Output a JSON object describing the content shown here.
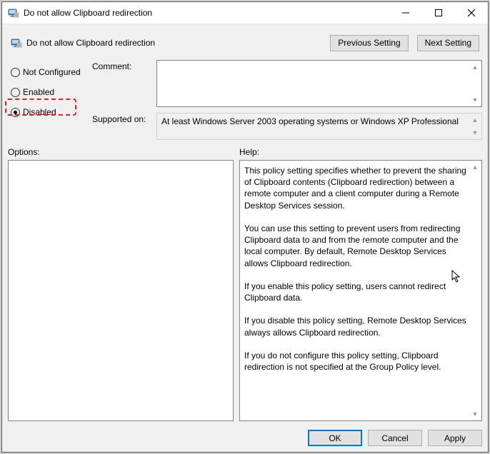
{
  "window": {
    "title": "Do not allow Clipboard redirection",
    "subtitle": "Do not allow Clipboard redirection"
  },
  "nav": {
    "previous": "Previous Setting",
    "next": "Next Setting"
  },
  "radios": {
    "not_configured": "Not Configured",
    "enabled": "Enabled",
    "disabled": "Disabled",
    "selected": "disabled"
  },
  "labels": {
    "comment": "Comment:",
    "supported": "Supported on:",
    "options": "Options:",
    "help": "Help:"
  },
  "comment_value": "",
  "supported_value": "At least Windows Server 2003 operating systems or Windows XP Professional",
  "options_value": "",
  "help_value": "This policy setting specifies whether to prevent the sharing of Clipboard contents (Clipboard redirection) between a remote computer and a client computer during a Remote Desktop Services session.\n\nYou can use this setting to prevent users from redirecting Clipboard data to and from the remote computer and the local computer. By default, Remote Desktop Services allows Clipboard redirection.\n\nIf you enable this policy setting, users cannot redirect Clipboard data.\n\nIf you disable this policy setting, Remote Desktop Services always allows Clipboard redirection.\n\nIf you do not configure this policy setting, Clipboard redirection is not specified at the Group Policy level.",
  "buttons": {
    "ok": "OK",
    "cancel": "Cancel",
    "apply": "Apply"
  }
}
